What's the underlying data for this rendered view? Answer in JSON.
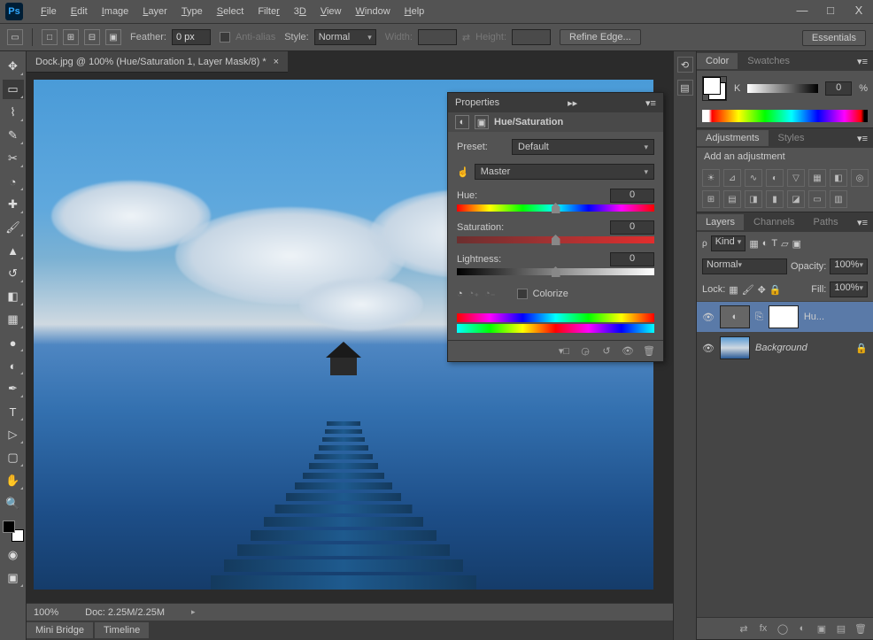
{
  "app": {
    "logo": "Ps"
  },
  "menu": [
    "File",
    "Edit",
    "Image",
    "Layer",
    "Type",
    "Select",
    "Filter",
    "3D",
    "View",
    "Window",
    "Help"
  ],
  "window_controls": {
    "min": "—",
    "max": "□",
    "close": "X"
  },
  "optionsbar": {
    "feather_label": "Feather:",
    "feather_value": "0 px",
    "antialias": "Anti-alias",
    "style_label": "Style:",
    "style_value": "Normal",
    "width_label": "Width:",
    "height_label": "Height:",
    "refine": "Refine Edge...",
    "workspace": "Essentials"
  },
  "document": {
    "tab_title": "Dock.jpg @ 100% (Hue/Saturation 1, Layer Mask/8) *",
    "zoom": "100%",
    "doc_size": "Doc: 2.25M/2.25M"
  },
  "tools": [
    "move",
    "marquee",
    "lasso",
    "quick-select",
    "crop",
    "eyedropper",
    "healing",
    "brush",
    "clone",
    "history-brush",
    "eraser",
    "gradient",
    "blur",
    "dodge",
    "pen",
    "type",
    "path-select",
    "rectangle",
    "hand",
    "zoom"
  ],
  "bottom_tabs": [
    "Mini Bridge",
    "Timeline"
  ],
  "color_panel": {
    "tabs": [
      "Color",
      "Swatches"
    ],
    "k_label": "K",
    "k_value": "0",
    "pct": "%"
  },
  "adjustments_panel": {
    "tabs": [
      "Adjustments",
      "Styles"
    ],
    "heading": "Add an adjustment",
    "icons": [
      "brightness",
      "levels",
      "curves",
      "exposure",
      "vibrance",
      "hue",
      "bw",
      "photo-filter",
      "channel-mixer",
      "color-lookup",
      "invert",
      "posterize",
      "threshold",
      "gradient-map",
      "selective"
    ]
  },
  "layers_panel": {
    "tabs": [
      "Layers",
      "Channels",
      "Paths"
    ],
    "kind_label": "Kind",
    "blend_mode": "Normal",
    "opacity_label": "Opacity:",
    "opacity_value": "100%",
    "lock_label": "Lock:",
    "fill_label": "Fill:",
    "fill_value": "100%",
    "layers": [
      {
        "name": "Hu...",
        "type": "adjustment",
        "visible": true
      },
      {
        "name": "Background",
        "type": "image",
        "visible": true,
        "locked": true
      }
    ],
    "footer_icons": [
      "link",
      "fx",
      "mask",
      "adj",
      "group",
      "new",
      "trash"
    ]
  },
  "properties": {
    "title": "Properties",
    "subtitle": "Hue/Saturation",
    "preset_label": "Preset:",
    "preset_value": "Default",
    "channel_value": "Master",
    "hue_label": "Hue:",
    "hue_value": "0",
    "sat_label": "Saturation:",
    "sat_value": "0",
    "light_label": "Lightness:",
    "light_value": "0",
    "colorize": "Colorize",
    "footer_icons": [
      "clip",
      "view",
      "reset",
      "visibility",
      "trash"
    ]
  }
}
